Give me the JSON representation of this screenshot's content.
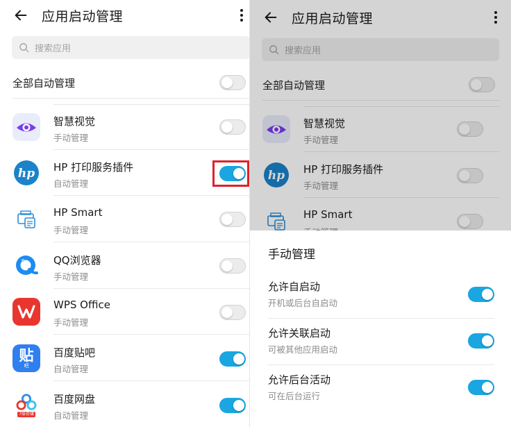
{
  "left": {
    "header": {
      "title": "应用启动管理"
    },
    "search": {
      "placeholder": "搜索应用"
    },
    "all_auto": {
      "label": "全部自动管理",
      "on": false
    },
    "apps": [
      {
        "name": "智慧视觉",
        "mode": "手动管理",
        "on": false,
        "icon": "smart-vision-icon"
      },
      {
        "name": "HP 打印服务插件",
        "mode": "自动管理",
        "on": true,
        "icon": "hp-icon",
        "highlighted": true
      },
      {
        "name": "HP Smart",
        "mode": "手动管理",
        "on": false,
        "icon": "hp-smart-icon"
      },
      {
        "name": "QQ浏览器",
        "mode": "手动管理",
        "on": false,
        "icon": "qq-browser-icon"
      },
      {
        "name": "WPS Office",
        "mode": "手动管理",
        "on": false,
        "icon": "wps-icon"
      },
      {
        "name": "百度贴吧",
        "mode": "自动管理",
        "on": true,
        "icon": "baidu-tieba-icon"
      },
      {
        "name": "百度网盘",
        "mode": "自动管理",
        "on": true,
        "icon": "baidu-netdisk-icon"
      }
    ],
    "icon_text": {
      "tieba": "贴",
      "tieba_small": "吧",
      "netdisk_badge": "7倍存储"
    }
  },
  "right": {
    "header": {
      "title": "应用启动管理"
    },
    "search": {
      "placeholder": "搜索应用"
    },
    "all_auto": {
      "label": "全部自动管理",
      "on": false
    },
    "apps": [
      {
        "name": "智慧视觉",
        "mode": "手动管理",
        "on": false
      },
      {
        "name": "HP 打印服务插件",
        "mode": "手动管理",
        "on": false
      },
      {
        "name": "HP Smart",
        "mode": "手动管理",
        "on": false
      }
    ],
    "sheet": {
      "title": "手动管理",
      "items": [
        {
          "label": "允许自启动",
          "desc": "开机或后台自启动",
          "on": true
        },
        {
          "label": "允许关联启动",
          "desc": "可被其他应用启动",
          "on": true
        },
        {
          "label": "允许后台活动",
          "desc": "可在后台运行",
          "on": true
        }
      ]
    }
  },
  "colors": {
    "accent": "#1aa6e1",
    "highlight": "#e0202a",
    "wps": "#e8362f",
    "tieba": "#2f7ff0",
    "qq": "#1c8cf0",
    "hp": "#1a83c9"
  }
}
